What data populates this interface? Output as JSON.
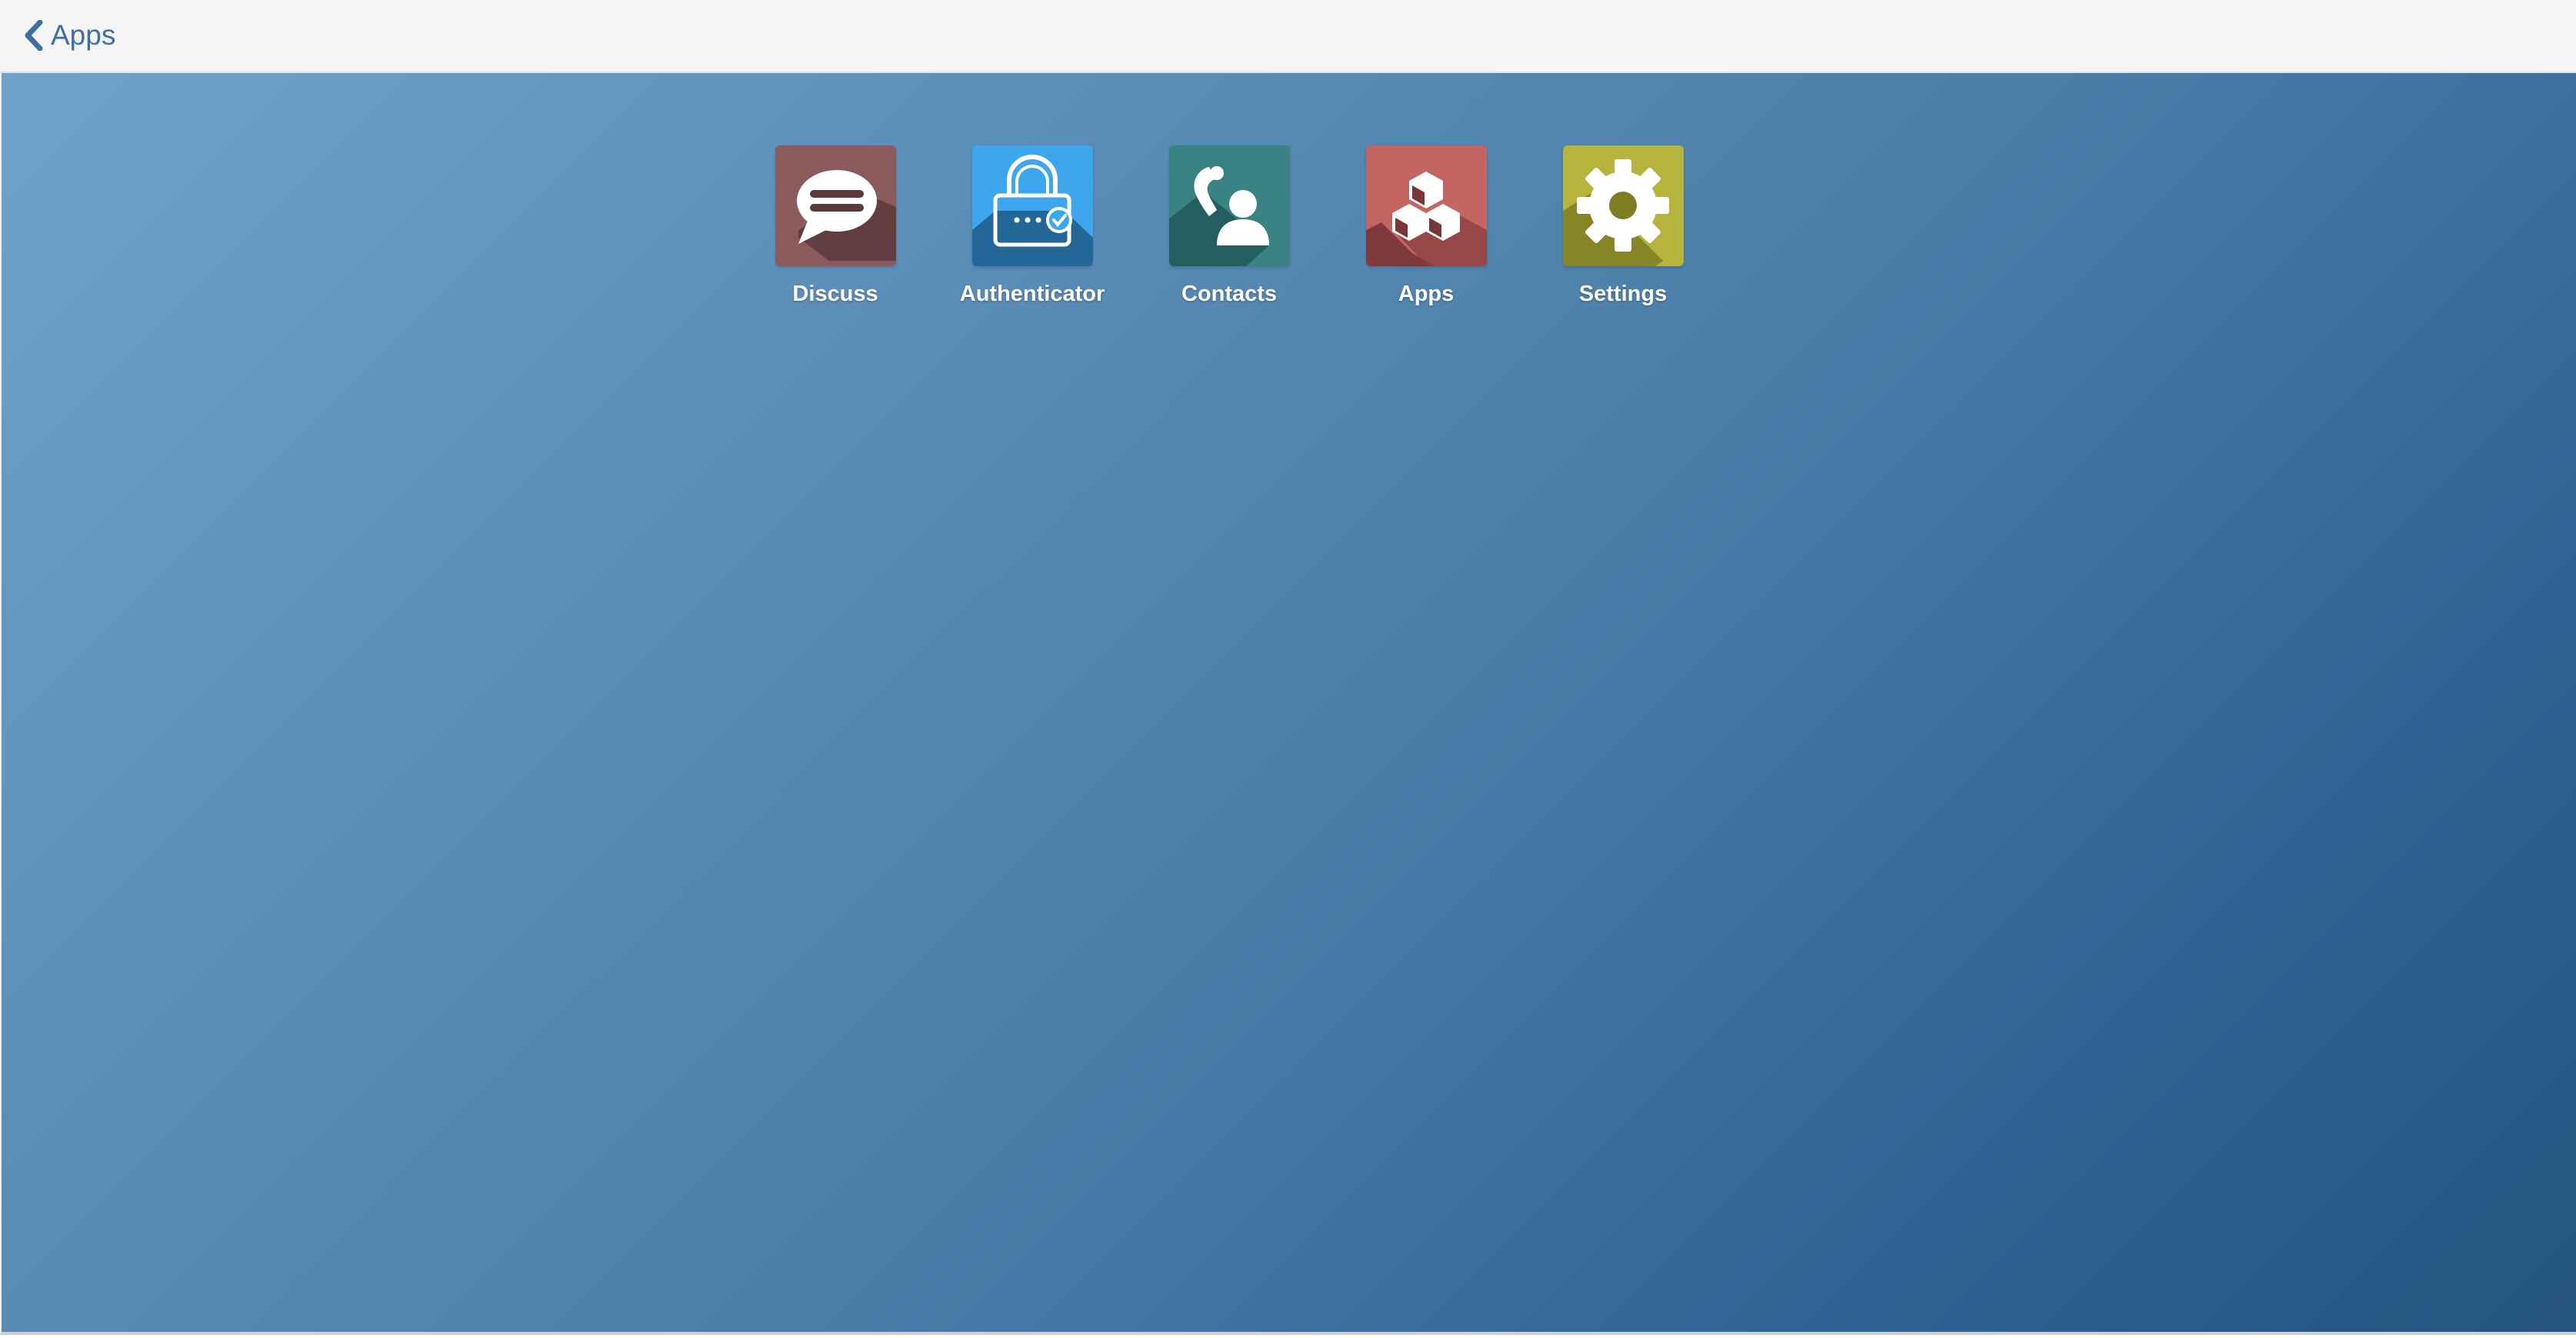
{
  "header": {
    "back_label": "Apps",
    "back_icon": "chevron-left-icon",
    "accent_color": "#3d6fa3"
  },
  "apps": [
    {
      "label": "Discuss",
      "icon": "chat-bubble-icon",
      "color": "#8a5a5c"
    },
    {
      "label": "Authenticator",
      "icon": "lock-icon",
      "color": "#3ea6ec"
    },
    {
      "label": "Contacts",
      "icon": "phone-person-icon",
      "color": "#3a8384"
    },
    {
      "label": "Apps",
      "icon": "cubes-icon",
      "color": "#c46562"
    },
    {
      "label": "Settings",
      "icon": "gear-icon",
      "color": "#b6b43c"
    }
  ]
}
